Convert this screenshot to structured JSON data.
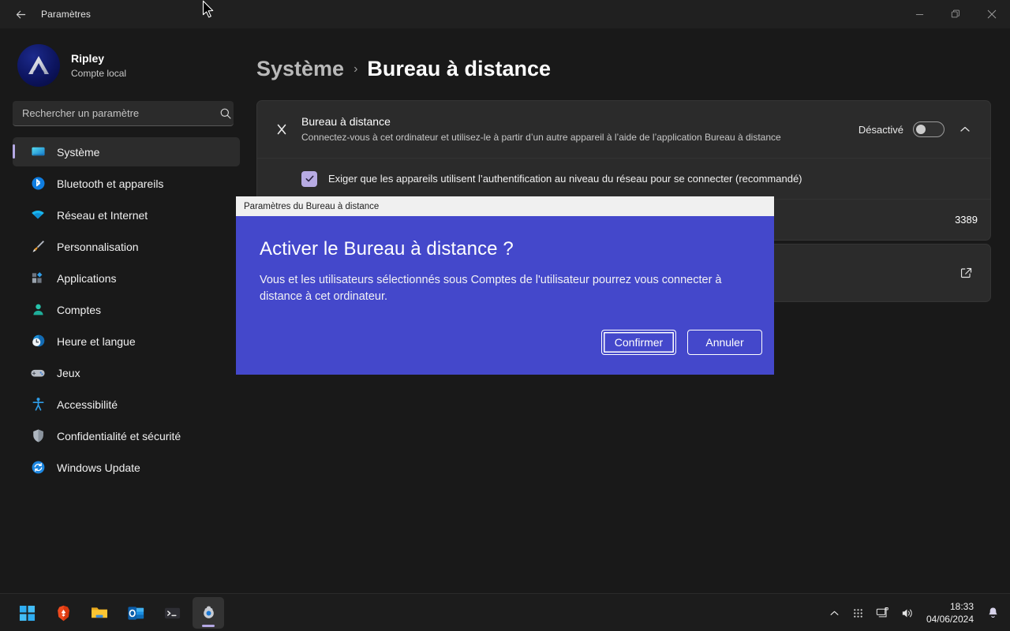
{
  "window": {
    "title": "Paramètres",
    "back_icon": "arrow-left-icon",
    "controls": {
      "minimize": "minimize-icon",
      "maximize": "restore-icon",
      "close": "close-icon"
    }
  },
  "sidebar": {
    "account": {
      "name": "Ripley",
      "subtitle": "Compte local",
      "avatar_icon": "user-avatar"
    },
    "search": {
      "placeholder": "Rechercher un paramètre",
      "value": "",
      "icon": "search-icon"
    },
    "items": [
      {
        "label": "Système",
        "icon": "monitor-icon",
        "selected": true
      },
      {
        "label": "Bluetooth et appareils",
        "icon": "bluetooth-icon",
        "selected": false
      },
      {
        "label": "Réseau et Internet",
        "icon": "wifi-icon",
        "selected": false
      },
      {
        "label": "Personnalisation",
        "icon": "paintbrush-icon",
        "selected": false
      },
      {
        "label": "Applications",
        "icon": "apps-icon",
        "selected": false
      },
      {
        "label": "Comptes",
        "icon": "person-icon",
        "selected": false
      },
      {
        "label": "Heure et langue",
        "icon": "clock-globe-icon",
        "selected": false
      },
      {
        "label": "Jeux",
        "icon": "gamepad-icon",
        "selected": false
      },
      {
        "label": "Accessibilité",
        "icon": "accessibility-icon",
        "selected": false
      },
      {
        "label": "Confidentialité et sécurité",
        "icon": "shield-icon",
        "selected": false
      },
      {
        "label": "Windows Update",
        "icon": "update-icon",
        "selected": false
      }
    ]
  },
  "main": {
    "breadcrumb": {
      "parent": "Système",
      "separator": "›",
      "current": "Bureau à distance"
    },
    "remote_desktop_card": {
      "icon": "remote-desktop-icon",
      "title": "Bureau à distance",
      "description": "Connectez-vous à cet ordinateur et utilisez-le à partir d’un autre appareil à l’aide de l’application Bureau à distance",
      "toggle_label": "Désactivé",
      "toggle_state": "off",
      "expand_icon": "chevron-up-icon"
    },
    "nla_row": {
      "checkbox_state": "checked",
      "label": "Exiger que les appareils utilisent l’authentification au niveau du réseau pour se connecter (recommandé)"
    },
    "port_row": {
      "value": "3389"
    },
    "link_row": {
      "icon": "external-link-icon"
    }
  },
  "dialog": {
    "titlebar": "Paramètres du Bureau à distance",
    "heading": "Activer le Bureau à distance ?",
    "body": "Vous et les utilisateurs sélectionnés sous Comptes de l'utilisateur pourrez vous connecter à distance à cet ordinateur.",
    "confirm_label": "Confirmer",
    "cancel_label": "Annuler",
    "background_color": "#4448cb"
  },
  "taskbar": {
    "items": [
      {
        "name": "start",
        "icon": "windows-start-icon",
        "active": false
      },
      {
        "name": "brave",
        "icon": "brave-browser-icon",
        "active": false
      },
      {
        "name": "file-explorer",
        "icon": "folder-icon",
        "active": false
      },
      {
        "name": "outlook",
        "icon": "outlook-icon",
        "active": false
      },
      {
        "name": "terminal",
        "icon": "terminal-icon",
        "active": false
      },
      {
        "name": "settings",
        "icon": "gear-icon",
        "active": true
      }
    ],
    "tray": {
      "overflow_icon": "chevron-up-icon",
      "apps_icon": "dots-grid-icon",
      "network_icon": "network-icon",
      "volume_icon": "speaker-icon",
      "notification_icon": "bell-icon",
      "time": "18:33",
      "date": "04/06/2024"
    }
  },
  "theme": {
    "accent": "#b4a8e4",
    "dialog": "#4448cb",
    "background": "#191919",
    "card": "#2b2b2b"
  }
}
